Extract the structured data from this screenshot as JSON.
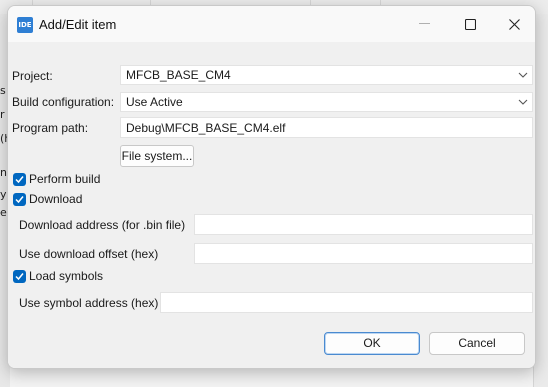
{
  "dialog": {
    "title": "Add/Edit item",
    "app_icon_text": "IDE"
  },
  "form": {
    "project_label": "Project:",
    "project_value": "MFCB_BASE_CM4",
    "build_config_label": "Build configuration:",
    "build_config_value": "Use Active",
    "program_path_label": "Program path:",
    "program_path_value": "Debug\\MFCB_BASE_CM4.elf",
    "file_system_button": "File system...",
    "perform_build_label": "Perform build",
    "perform_build_checked": true,
    "download_label": "Download",
    "download_checked": true,
    "download_address_label": "Download address (for .bin file)",
    "download_address_value": "",
    "download_offset_label": "Use download offset (hex)",
    "download_offset_value": "",
    "load_symbols_label": "Load symbols",
    "load_symbols_checked": true,
    "symbol_address_label": "Use symbol address (hex)",
    "symbol_address_value": ""
  },
  "buttons": {
    "ok": "OK",
    "cancel": "Cancel"
  },
  "background": {
    "fragments": [
      "s",
      "r (",
      "(h",
      "na",
      "y",
      "ec"
    ]
  },
  "colors": {
    "accent": "#0067c0",
    "dialog_bg": "#f0f0f0"
  }
}
